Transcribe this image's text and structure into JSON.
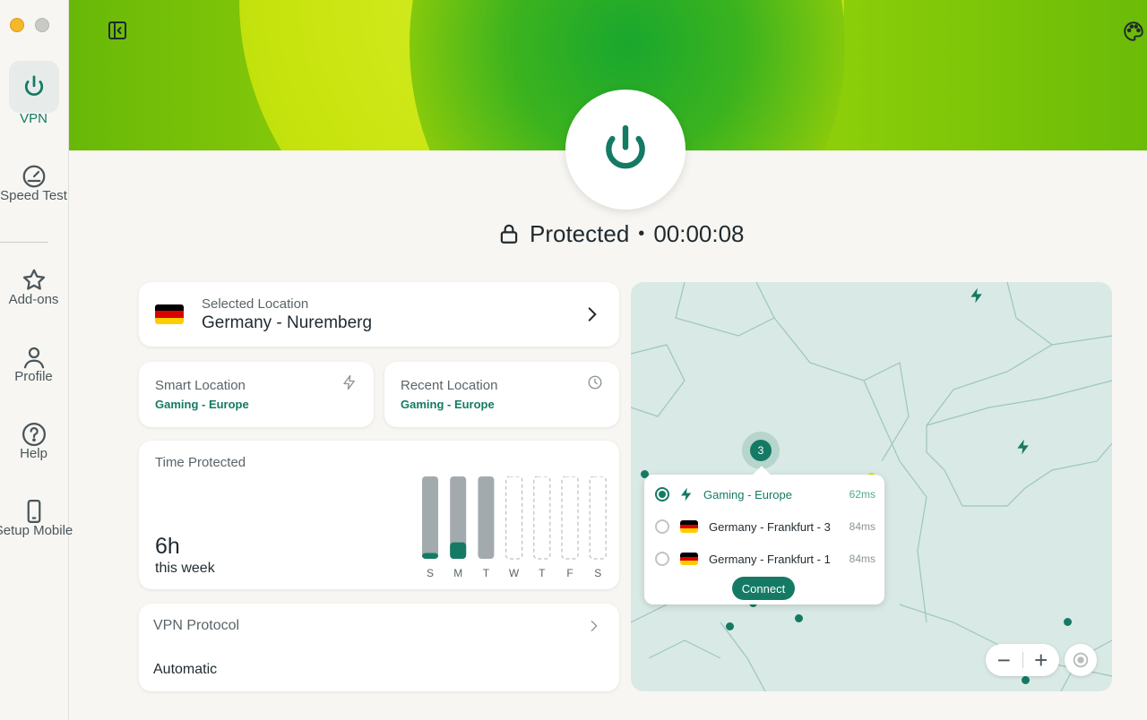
{
  "sidebar": {
    "items": [
      {
        "label": "VPN",
        "icon": "power-icon",
        "active": true
      },
      {
        "label": "Speed Test",
        "icon": "speedometer-icon"
      },
      {
        "label": "Add-ons",
        "icon": "star-icon"
      },
      {
        "label": "Profile",
        "icon": "person-icon"
      },
      {
        "label": "Help",
        "icon": "question-icon"
      },
      {
        "label": "Setup Mobile",
        "icon": "mobile-icon"
      }
    ]
  },
  "status": {
    "text": "Protected",
    "separator": "•",
    "timer": "00:00:08"
  },
  "selected_location": {
    "caption": "Selected Location",
    "value": "Germany - Nuremberg"
  },
  "smart_location": {
    "caption": "Smart Location",
    "value": "Gaming - Europe"
  },
  "recent_location": {
    "caption": "Recent Location",
    "value": "Gaming - Europe"
  },
  "time_protected": {
    "caption": "Time Protected",
    "total": "6h",
    "period": "this week",
    "days": [
      "S",
      "M",
      "T",
      "W",
      "T",
      "F",
      "S"
    ],
    "levels": [
      0.07,
      0.2,
      0,
      null,
      null,
      null,
      null
    ]
  },
  "vpn_protocol": {
    "caption": "VPN Protocol",
    "value": "Automatic"
  },
  "map": {
    "cluster_count": "3",
    "popup": {
      "rows": [
        {
          "name": "Gaming - Europe",
          "latency": "62ms",
          "selected": true,
          "icon": "bolt-icon"
        },
        {
          "name": "Germany - Frankfurt - 3",
          "latency": "84ms",
          "selected": false,
          "icon": "germany-flag"
        },
        {
          "name": "Germany - Frankfurt - 1",
          "latency": "84ms",
          "selected": false,
          "icon": "germany-flag"
        }
      ],
      "connect_label": "Connect"
    },
    "zoom_out": "−",
    "zoom_in": "+"
  },
  "colors": {
    "accent": "#157a64",
    "hero_lime": "#c8e40e",
    "hero_green": "#19a72e"
  }
}
